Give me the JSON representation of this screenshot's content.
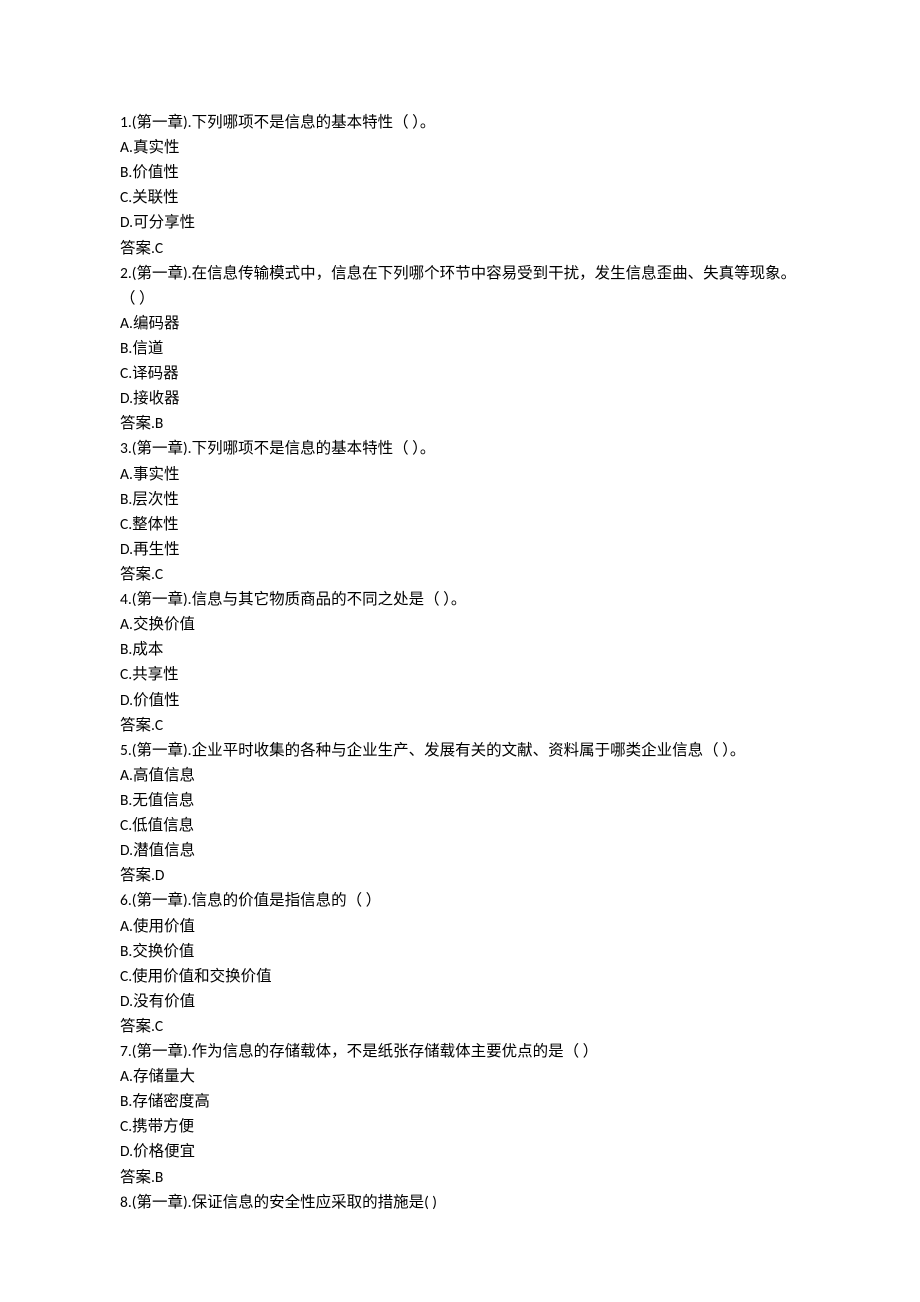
{
  "questions": [
    {
      "stem": "1.(第一章).下列哪项不是信息的基本特性（  ）。",
      "options": [
        "A.真实性",
        "B.价值性",
        "C.关联性",
        "D.可分享性"
      ],
      "answer": "答案.C"
    },
    {
      "stem": "2.(第一章).在信息传输模式中，信息在下列哪个环节中容易受到干扰，发生信息歪曲、失真等现象。（  ）",
      "options": [
        "A.编码器",
        "B.信道",
        "C.译码器",
        "D.接收器"
      ],
      "answer": "答案.B"
    },
    {
      "stem": "3.(第一章).下列哪项不是信息的基本特性（  ）。",
      "options": [
        "A.事实性",
        "B.层次性",
        "C.整体性",
        "D.再生性"
      ],
      "answer": "答案.C"
    },
    {
      "stem": "4.(第一章).信息与其它物质商品的不同之处是（  ）。",
      "options": [
        "A.交换价值",
        "B.成本",
        "C.共享性",
        "D.价值性"
      ],
      "answer": "答案.C"
    },
    {
      "stem": "5.(第一章).企业平时收集的各种与企业生产、发展有关的文献、资料属于哪类企业信息（  ）。",
      "options": [
        "A.高值信息",
        "B.无值信息",
        "C.低值信息",
        "D.潜值信息"
      ],
      "answer": "答案.D"
    },
    {
      "stem": "6.(第一章).信息的价值是指信息的（  ）",
      "options": [
        "A.使用价值",
        "B.交换价值",
        "C.使用价值和交换价值",
        "D.没有价值"
      ],
      "answer": "答案.C"
    },
    {
      "stem": "7.(第一章).作为信息的存储载体，不是纸张存储载体主要优点的是（  ）",
      "options": [
        "A.存储量大",
        "B.存储密度高",
        "C.携带方便",
        "D.价格便宜"
      ],
      "answer": "答案.B"
    },
    {
      "stem": "8.(第一章).保证信息的安全性应采取的措施是(  )",
      "options": [],
      "answer": ""
    }
  ]
}
